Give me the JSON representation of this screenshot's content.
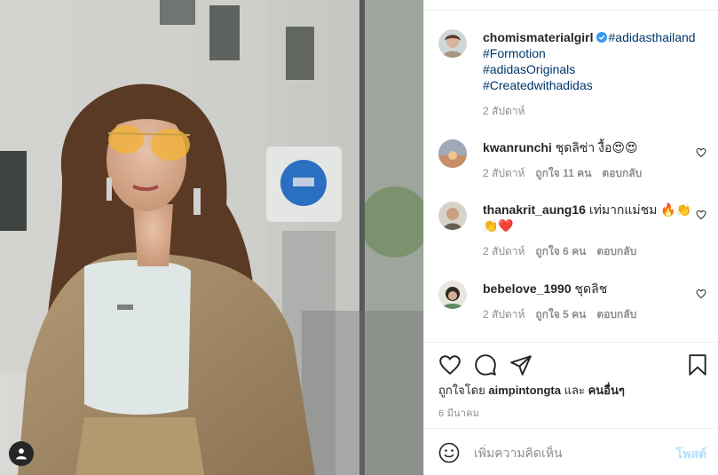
{
  "post": {
    "image_alt": "",
    "user_tags_icon": "person-icon"
  },
  "caption": {
    "username": "chomismaterialgirl",
    "verified_icon": "verified-badge-icon",
    "hashtags": [
      "#adidasthailand",
      "#Formotion",
      "#adidasOriginals",
      "#Createdwithadidas"
    ],
    "time": "2 สัปดาห์"
  },
  "comments": [
    {
      "username": "kwanrunchi",
      "text": "ชุดลิซ่า งื้อ😍😍",
      "time": "2 สัปดาห์",
      "likes": "ถูกใจ 11 คน",
      "reply": "ตอบกลับ"
    },
    {
      "username": "thanakrit_aung16",
      "text": "เท่มากแม่ชม 🔥👏",
      "text_line2": "👏❤️",
      "time": "2 สัปดาห์",
      "likes": "ถูกใจ 6 คน",
      "reply": "ตอบกลับ"
    },
    {
      "username": "bebelove_1990",
      "text": "ชุดลิช",
      "time": "2 สัปดาห์",
      "likes": "ถูกใจ 5 คน",
      "reply": "ตอบกลับ"
    }
  ],
  "actions": {
    "like_icon": "heart-icon",
    "comment_icon": "comment-icon",
    "share_icon": "share-icon",
    "save_icon": "bookmark-icon"
  },
  "likes_line": {
    "prefix": "ถูกใจโดย",
    "user": "aimpintongta",
    "joiner": "และ",
    "others": "คนอื่นๆ"
  },
  "post_date": "6 มีนาคม",
  "add_comment": {
    "emoji_icon": "emoji-icon",
    "placeholder": "เพิ่มความคิดเห็น",
    "post_label": "โพสต์"
  }
}
